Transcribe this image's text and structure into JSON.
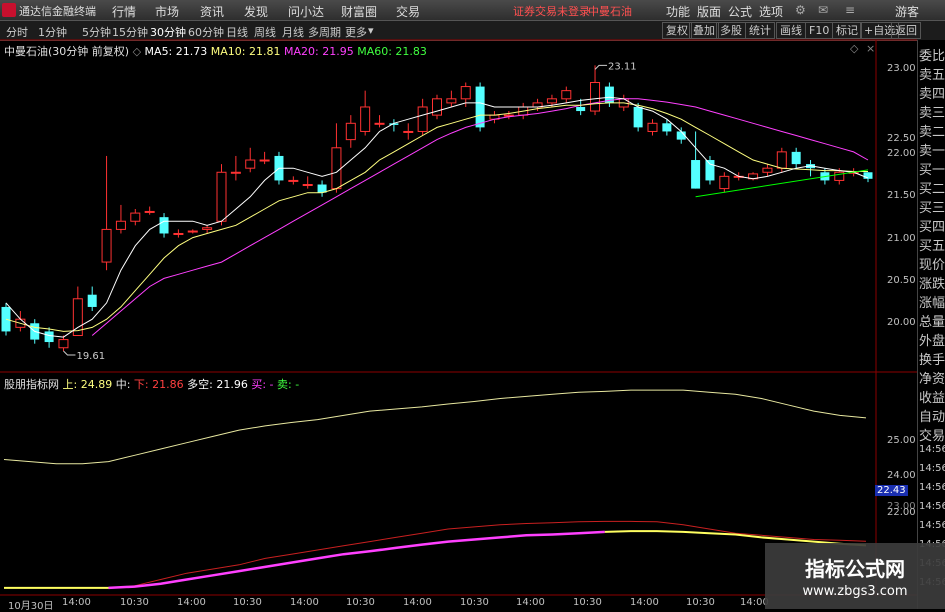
{
  "app": {
    "title": "通达信金融终端",
    "menu": [
      "行情",
      "市场",
      "资讯",
      "发现",
      "问小达",
      "财富圈",
      "交易"
    ],
    "notice": "证券交易未登录",
    "stock_title": "中曼石油",
    "right_menu": [
      "功能",
      "版面",
      "公式",
      "选项"
    ],
    "user": "游客"
  },
  "toolbar": {
    "periods": [
      "分时",
      "1分钟",
      "5分钟",
      "15分钟",
      "30分钟",
      "60分钟",
      "日线",
      "周线",
      "月线",
      "多周期",
      "更多"
    ],
    "active_period": "30分钟",
    "right_buttons": [
      "复权",
      "叠加",
      "多股",
      "统计",
      "画线",
      "F10",
      "标记",
      "+自选",
      "返回"
    ]
  },
  "main_info": {
    "name": "中曼石油(30分钟 前复权)",
    "ma5_label": "MA5: 21.73",
    "ma10_label": "MA10: 21.81",
    "ma20_label": "MA20: 21.95",
    "ma60_label": "MA60: 21.83",
    "high_mark": "23.11",
    "low_mark": "19.61"
  },
  "indicator_info": {
    "name": "股朋指标网",
    "upper": "上: 24.89",
    "middle_label": "中:",
    "lower": "下: 21.86",
    "longshort": "多空: 21.96",
    "buy": "买: -",
    "sell": "卖: -"
  },
  "price_axis": [
    "23.00",
    "22.50",
    "22.00",
    "21.50",
    "21.00",
    "20.50",
    "20.00"
  ],
  "ind_axis": [
    "25.00",
    "24.00",
    "23.00",
    "22.00"
  ],
  "current_tag": "22.43",
  "right_panel": [
    "委比",
    "卖五",
    "卖四",
    "卖三",
    "卖二",
    "卖一",
    "买一",
    "买二",
    "买三",
    "买四",
    "买五",
    "现价",
    "涨跌",
    "涨幅",
    "总量",
    "外盘",
    "换手",
    "净资",
    "收益",
    "自动",
    "交易",
    "14:56",
    "14:56",
    "14:56",
    "14:56",
    "14:56",
    "14:56",
    "14:56",
    "14:56"
  ],
  "time_axis": [
    "10月30日",
    "14:00",
    "10:30",
    "14:00",
    "10:30",
    "14:00",
    "10:30",
    "14:00",
    "10:30",
    "14:00",
    "10:30",
    "14:00",
    "10:30",
    "14:00"
  ],
  "watermark": {
    "line1": "指标公式网",
    "line2": "www.zbgs3.com"
  },
  "colors": {
    "up": "#ff3232",
    "down": "#54ffff",
    "ma5": "#ffffff",
    "ma10": "#ffff80",
    "ma20": "#ff40ff",
    "ma60": "#00ff00",
    "border": "#8b0000"
  },
  "chart_data": {
    "type": "candlestick",
    "ylim": [
      19.5,
      23.2
    ],
    "candles": [
      [
        20.15,
        19.85,
        20.2,
        19.8
      ],
      [
        19.9,
        20.0,
        20.1,
        19.85
      ],
      [
        19.95,
        19.75,
        20.0,
        19.7
      ],
      [
        19.85,
        19.72,
        19.9,
        19.65
      ],
      [
        19.65,
        19.75,
        19.8,
        19.61
      ],
      [
        19.8,
        20.25,
        20.4,
        19.8
      ],
      [
        20.3,
        20.15,
        20.4,
        20.1
      ],
      [
        20.7,
        21.1,
        22.0,
        20.6
      ],
      [
        21.1,
        21.2,
        21.4,
        21.05
      ],
      [
        21.2,
        21.3,
        21.35,
        21.15
      ],
      [
        21.32,
        21.32,
        21.38,
        21.28
      ],
      [
        21.25,
        21.05,
        21.3,
        21.0
      ],
      [
        21.05,
        21.05,
        21.1,
        21.0
      ],
      [
        21.08,
        21.08,
        21.1,
        21.05
      ],
      [
        21.1,
        21.12,
        21.15,
        21.05
      ],
      [
        21.2,
        21.8,
        21.9,
        21.15
      ],
      [
        21.8,
        21.8,
        22.0,
        21.7
      ],
      [
        21.85,
        21.95,
        22.1,
        21.8
      ],
      [
        21.95,
        21.95,
        22.05,
        21.9
      ],
      [
        22.0,
        21.7,
        22.05,
        21.65
      ],
      [
        21.7,
        21.7,
        21.75,
        21.65
      ],
      [
        21.65,
        21.65,
        21.75,
        21.6
      ],
      [
        21.65,
        21.55,
        21.7,
        21.5
      ],
      [
        21.6,
        22.1,
        22.4,
        21.55
      ],
      [
        22.2,
        22.4,
        22.5,
        22.1
      ],
      [
        22.3,
        22.6,
        22.8,
        22.25
      ],
      [
        22.4,
        22.4,
        22.5,
        22.35
      ],
      [
        22.4,
        22.38,
        22.45,
        22.3
      ],
      [
        22.3,
        22.3,
        22.4,
        22.2
      ],
      [
        22.3,
        22.6,
        22.7,
        22.25
      ],
      [
        22.5,
        22.7,
        22.75,
        22.45
      ],
      [
        22.65,
        22.7,
        22.8,
        22.6
      ],
      [
        22.7,
        22.85,
        22.9,
        22.6
      ],
      [
        22.85,
        22.35,
        22.9,
        22.3
      ],
      [
        22.45,
        22.5,
        22.55,
        22.4
      ],
      [
        22.5,
        22.5,
        22.55,
        22.45
      ],
      [
        22.5,
        22.6,
        22.65,
        22.45
      ],
      [
        22.6,
        22.65,
        22.7,
        22.55
      ],
      [
        22.65,
        22.7,
        22.75,
        22.6
      ],
      [
        22.7,
        22.8,
        22.85,
        22.65
      ],
      [
        22.6,
        22.55,
        22.7,
        22.5
      ],
      [
        22.55,
        22.9,
        23.11,
        22.5
      ],
      [
        22.85,
        22.65,
        22.9,
        22.6
      ],
      [
        22.6,
        22.7,
        22.75,
        22.55
      ],
      [
        22.6,
        22.35,
        22.65,
        22.3
      ],
      [
        22.3,
        22.4,
        22.45,
        22.25
      ],
      [
        22.4,
        22.3,
        22.45,
        22.25
      ],
      [
        22.3,
        22.2,
        22.35,
        22.15
      ],
      [
        21.95,
        21.6,
        22.3,
        21.6
      ],
      [
        21.95,
        21.7,
        22.0,
        21.65
      ],
      [
        21.6,
        21.75,
        21.8,
        21.55
      ],
      [
        21.75,
        21.75,
        21.8,
        21.7
      ],
      [
        21.72,
        21.78,
        21.8,
        21.7
      ],
      [
        21.8,
        21.85,
        21.9,
        21.75
      ],
      [
        21.85,
        22.05,
        22.1,
        21.8
      ],
      [
        22.05,
        21.9,
        22.1,
        21.85
      ],
      [
        21.9,
        21.85,
        21.95,
        21.75
      ],
      [
        21.8,
        21.7,
        21.85,
        21.65
      ],
      [
        21.7,
        21.8,
        21.85,
        21.65
      ],
      [
        21.8,
        21.8,
        21.85,
        21.75
      ],
      [
        21.8,
        21.72,
        21.8,
        21.68
      ]
    ],
    "ma5": [
      20.2,
      20.0,
      19.85,
      19.8,
      19.78,
      19.9,
      20.0,
      20.2,
      20.6,
      20.9,
      21.1,
      21.2,
      21.2,
      21.2,
      21.15,
      21.2,
      21.35,
      21.5,
      21.7,
      21.85,
      21.85,
      21.8,
      21.75,
      21.8,
      21.95,
      22.1,
      22.3,
      22.4,
      22.45,
      22.5,
      22.55,
      22.6,
      22.65,
      22.65,
      22.6,
      22.6,
      22.6,
      22.6,
      22.62,
      22.65,
      22.68,
      22.7,
      22.72,
      22.7,
      22.6,
      22.55,
      22.45,
      22.3,
      22.1,
      21.9,
      21.85,
      21.75,
      21.72,
      21.75,
      21.8,
      21.85,
      21.88,
      21.85,
      21.82,
      21.8,
      21.73
    ],
    "ma10": [
      20.0,
      19.95,
      19.9,
      19.88,
      19.85,
      19.86,
      19.9,
      20.0,
      20.15,
      20.35,
      20.55,
      20.75,
      20.9,
      21.0,
      21.05,
      21.1,
      21.15,
      21.25,
      21.35,
      21.45,
      21.5,
      21.55,
      21.55,
      21.6,
      21.7,
      21.8,
      21.95,
      22.05,
      22.15,
      22.25,
      22.35,
      22.4,
      22.45,
      22.5,
      22.5,
      22.52,
      22.55,
      22.58,
      22.6,
      22.62,
      22.62,
      22.64,
      22.65,
      22.65,
      22.62,
      22.58,
      22.52,
      22.45,
      22.35,
      22.25,
      22.15,
      22.05,
      21.95,
      21.9,
      21.85,
      21.84,
      21.83,
      21.82,
      21.82,
      21.81,
      21.81
    ],
    "ma20": [
      null,
      null,
      null,
      null,
      null,
      null,
      19.8,
      19.95,
      20.1,
      20.25,
      20.4,
      20.5,
      20.55,
      20.6,
      20.65,
      20.7,
      20.8,
      20.9,
      21.0,
      21.1,
      21.2,
      21.3,
      21.4,
      21.5,
      21.6,
      21.7,
      21.8,
      21.9,
      22.0,
      22.1,
      22.2,
      22.28,
      22.35,
      22.4,
      22.45,
      22.48,
      22.5,
      22.52,
      22.55,
      22.58,
      22.62,
      22.65,
      22.68,
      22.7,
      22.7,
      22.68,
      22.66,
      22.63,
      22.6,
      22.55,
      22.5,
      22.45,
      22.4,
      22.35,
      22.3,
      22.25,
      22.2,
      22.15,
      22.1,
      22.05,
      21.95
    ],
    "ma60": {
      "from": [
        48,
        21.5
      ],
      "to": [
        60,
        21.83
      ]
    },
    "indicator": {
      "ylim": [
        20.8,
        25.6
      ],
      "upper": [
        23.9,
        23.85,
        23.8,
        23.8,
        23.85,
        24.0,
        24.15,
        24.3,
        24.45,
        24.6,
        24.7,
        24.78,
        24.85,
        24.95,
        25.05,
        25.1,
        25.15,
        25.22,
        25.28,
        25.35,
        25.4,
        25.45,
        25.5,
        25.52,
        25.55,
        25.55,
        25.55,
        25.5,
        25.45,
        25.35,
        25.2,
        25.05,
        24.95,
        24.89
      ],
      "middle": [
        20.85,
        20.85,
        20.85,
        20.85,
        20.85,
        20.9,
        21.05,
        21.2,
        21.3,
        21.4,
        21.55,
        21.65,
        21.75,
        21.85,
        21.95,
        22.05,
        22.15,
        22.25,
        22.3,
        22.35,
        22.38,
        22.4,
        22.42,
        22.43,
        22.43,
        22.42,
        22.35,
        22.25,
        22.15,
        22.1,
        22.05,
        22.0,
        21.98,
        21.96
      ],
      "lower": [
        20.85,
        20.85,
        20.85,
        20.85,
        20.85,
        20.88,
        20.95,
        21.05,
        21.15,
        21.25,
        21.35,
        21.45,
        21.55,
        21.65,
        21.72,
        21.8,
        21.88,
        21.95,
        22.0,
        22.05,
        22.1,
        22.12,
        22.15,
        22.18,
        22.2,
        22.2,
        22.18,
        22.15,
        22.12,
        22.05,
        22.0,
        21.95,
        21.9,
        21.86
      ]
    }
  }
}
